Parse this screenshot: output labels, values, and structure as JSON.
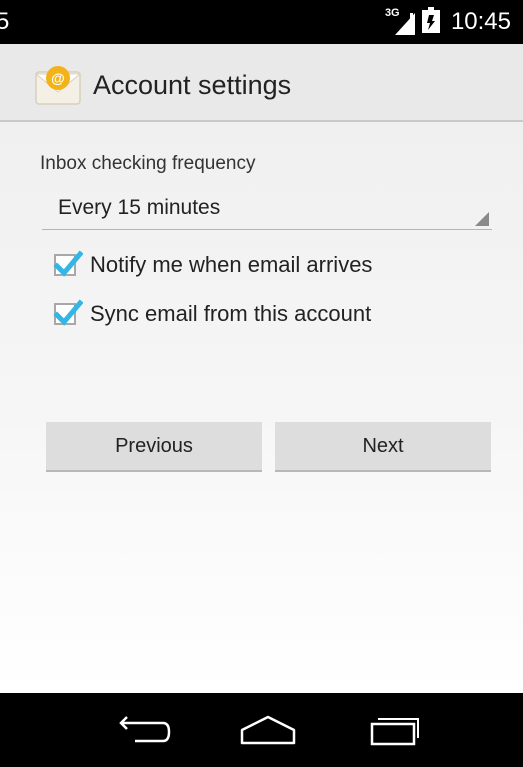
{
  "status_bar": {
    "left_fragment": "5",
    "network": "3G",
    "time": "10:45"
  },
  "action_bar": {
    "title": "Account settings",
    "icon": "email-app-icon"
  },
  "settings": {
    "frequency_label": "Inbox checking frequency",
    "frequency_value": "Every 15 minutes",
    "notify_label": "Notify me when email arrives",
    "notify_checked": true,
    "sync_label": "Sync email from this account",
    "sync_checked": true
  },
  "buttons": {
    "previous": "Previous",
    "next": "Next"
  },
  "navigation": {
    "back_icon": "back-icon",
    "home_icon": "home-icon",
    "recents_icon": "recent-apps-icon"
  },
  "colors": {
    "checkbox_accent": "#33b5e5",
    "action_bar": "#e9e9e9"
  }
}
